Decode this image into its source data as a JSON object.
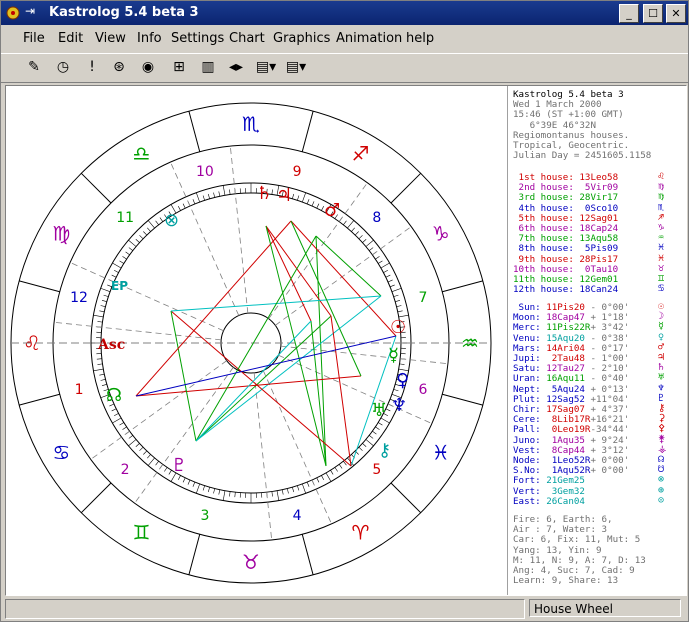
{
  "window": {
    "title": "Kastrolog 5.4 beta 3"
  },
  "menu": [
    "File",
    "Edit",
    "View",
    "Info",
    "Settings",
    "Chart",
    "Graphics",
    "Animation",
    "help"
  ],
  "toolbar_icons": [
    "open-icon",
    "clock-icon",
    "exclamation-icon",
    "wheel-icon",
    "wheel-target-icon",
    "grid-icon",
    "film-icon",
    "arrows-icon",
    "list-dropdown-icon",
    "list-dropdown-icon"
  ],
  "status": {
    "right": "House Wheel"
  },
  "chart_header": [
    "Kastrolog 5.4 beta 3",
    "Wed 1 March 2000",
    "15:46 (ST +1:00 GMT)",
    "   6°39E 46°32N",
    "Regiomontanus houses.",
    "Tropical, Geocentric.",
    "Julian Day = 2451605.1158"
  ],
  "houses": [
    {
      "label": "1st house:",
      "value": "13Leo58",
      "color": "#d00000"
    },
    {
      "label": "2nd house:",
      "value": " 5Vir09",
      "color": "#a000a0"
    },
    {
      "label": "3rd house:",
      "value": "28Vir17",
      "color": "#00a000"
    },
    {
      "label": "4th house:",
      "value": " 0Sco10",
      "color": "#0000c0"
    },
    {
      "label": "5th house:",
      "value": "12Sag01",
      "color": "#d00000"
    },
    {
      "label": "6th house:",
      "value": "18Cap24",
      "color": "#a000a0"
    },
    {
      "label": "7th house:",
      "value": "13Aqu58",
      "color": "#00a000"
    },
    {
      "label": "8th house:",
      "value": " 5Pis09",
      "color": "#0000c0"
    },
    {
      "label": "9th house:",
      "value": "28Pis17",
      "color": "#d00000"
    },
    {
      "label": "10th house:",
      "value": " 0Tau10",
      "color": "#a000a0"
    },
    {
      "label": "11th house:",
      "value": "12Gem01",
      "color": "#00a000"
    },
    {
      "label": "12th house:",
      "value": "18Can24",
      "color": "#0000c0"
    }
  ],
  "planets": [
    {
      "label": "Sun:",
      "value": "11Pis20",
      "extra": " - 0°00'",
      "color": "#d00000"
    },
    {
      "label": "Moon:",
      "value": "18Cap47",
      "extra": " + 1°18'",
      "color": "#a000a0"
    },
    {
      "label": "Merc:",
      "value": "11Pis22R",
      "extra": "+ 3°42'",
      "color": "#00a000"
    },
    {
      "label": "Venu:",
      "value": "15Aqu20",
      "extra": " - 0°38'",
      "color": "#00a0a0"
    },
    {
      "label": "Mars:",
      "value": "14Ari04",
      "extra": " - 0°17'",
      "color": "#d00000"
    },
    {
      "label": "Jupi:",
      "value": " 2Tau48",
      "extra": " - 1°00'",
      "color": "#d00000"
    },
    {
      "label": "Satu:",
      "value": "12Tau27",
      "extra": " - 2°10'",
      "color": "#a000a0"
    },
    {
      "label": "Uran:",
      "value": "16Aqu11",
      "extra": " - 0°40'",
      "color": "#00a000"
    },
    {
      "label": "Nept:",
      "value": " 5Aqu24",
      "extra": " + 0°13'",
      "color": "#0000c0"
    },
    {
      "label": "Plut:",
      "value": "12Sag52",
      "extra": " +11°04'",
      "color": "#0000c0"
    },
    {
      "label": "Chir:",
      "value": "17Sag07",
      "extra": " + 4°37'",
      "color": "#d00000"
    },
    {
      "label": "Cere:",
      "value": " 8Lib17R",
      "extra": "+16°21'",
      "color": "#d00000"
    },
    {
      "label": "Pall:",
      "value": " 0Leo19R",
      "extra": "-34°44'",
      "color": "#d00000"
    },
    {
      "label": "Juno:",
      "value": " 1Aqu35",
      "extra": " + 9°24'",
      "color": "#a000a0"
    },
    {
      "label": "Vest:",
      "value": " 8Cap44",
      "extra": " + 3°12'",
      "color": "#a000a0"
    },
    {
      "label": "Node:",
      "value": " 1Leo52R",
      "extra": "+ 0°00'",
      "color": "#0000c0"
    },
    {
      "label": "S.No:",
      "value": " 1Aqu52R",
      "extra": "+ 0°00'",
      "color": "#0000c0"
    },
    {
      "label": "Fort:",
      "value": "21Gem25",
      "extra": "",
      "color": "#00a0a0"
    },
    {
      "label": "Vert:",
      "value": " 3Gem32",
      "extra": "",
      "color": "#00a0a0"
    },
    {
      "label": "East:",
      "value": "26Can04",
      "extra": "",
      "color": "#00a0a0"
    }
  ],
  "planet_glyphs": [
    "☉",
    "☽",
    "☿",
    "♀",
    "♂",
    "♃",
    "♄",
    "♅",
    "♆",
    "♇",
    "⚷",
    "⚳",
    "⚴",
    "⚵",
    "⚶",
    "☊",
    "☋",
    "⊗",
    "⊕",
    "⊙"
  ],
  "house_glyphs": [
    "♌",
    "♍",
    "♍",
    "♏",
    "♐",
    "♑",
    "♒",
    "♓",
    "♓",
    "♉",
    "♊",
    "♋"
  ],
  "footer": [
    "Fire: 6, Earth: 6,",
    "Air : 7, Water: 3",
    "Car: 6, Fix: 11, Mut: 5",
    "Yang: 13, Yin: 9",
    "M: 11, N: 9, A: 7, D: 13",
    "Ang: 4, Suc: 7, Cad: 9",
    "Learn: 9, Share: 13"
  ],
  "wheel": {
    "sign_glyphs": [
      "♌",
      "♍",
      "♎",
      "♏",
      "♐",
      "♑",
      "♒",
      "♓",
      "♈",
      "♉",
      "♊",
      "♋"
    ],
    "house_numbers": [
      "1",
      "2",
      "3",
      "4",
      "5",
      "6",
      "7",
      "8",
      "9",
      "10",
      "11",
      "12"
    ],
    "asc_label": "Asc",
    "ep_label": "EP"
  }
}
